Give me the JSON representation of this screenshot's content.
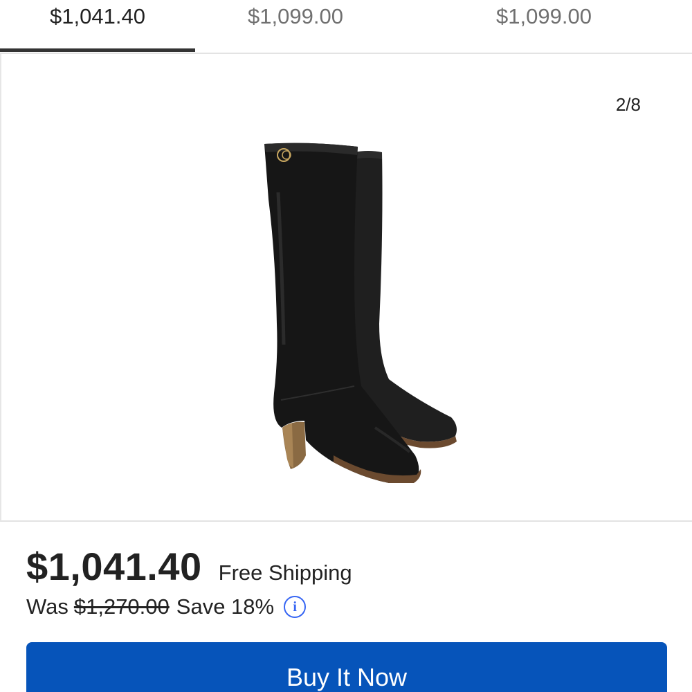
{
  "tabs": [
    {
      "label": "$1,041.40",
      "selected": true
    },
    {
      "label": "$1,099.00",
      "selected": false
    },
    {
      "label": "$1,099.00",
      "selected": false
    }
  ],
  "gallery": {
    "counter": "2/8",
    "image_alt_icon": "knee-high-boots-photo"
  },
  "pricing": {
    "price": "$1,041.40",
    "shipping": "Free Shipping",
    "was_label": "Was",
    "original_price": "$1,270.00",
    "savings": "Save 18%",
    "info_icon": "info-icon"
  },
  "actions": {
    "buy_now": "Buy It Now"
  },
  "colors": {
    "accent_blue": "#0654ba",
    "info_blue": "#3665f3",
    "tab_active": "#333333"
  }
}
